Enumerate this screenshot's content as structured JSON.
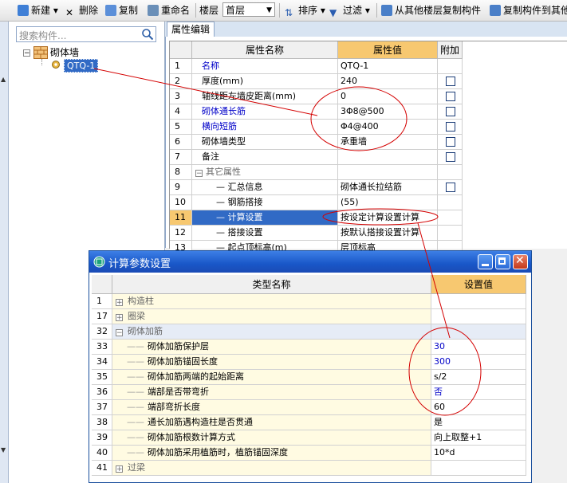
{
  "toolbar": {
    "new_label": "新建",
    "delete_label": "删除",
    "copy_label": "复制",
    "rename_label": "重命名",
    "floor_label": "楼层",
    "floor_value": "首层",
    "sort_label": "排序",
    "filter_label": "过滤",
    "copy_from_floor_label": "从其他楼层复制构件",
    "copy_to_floor_label": "复制构件到其他"
  },
  "left": {
    "search_placeholder": "搜索构件...",
    "tree_root": "砌体墙",
    "tree_child": "QTQ-1"
  },
  "props": {
    "tab": "属性编辑",
    "header_name": "属性名称",
    "header_value": "属性值",
    "header_extra": "附加",
    "rows": [
      {
        "n": "1",
        "name": "名称",
        "value": "QTQ-1",
        "blue": true,
        "check": false
      },
      {
        "n": "2",
        "name": "厚度(mm)",
        "value": "240",
        "blue": false,
        "check": true
      },
      {
        "n": "3",
        "name": "轴线距左墙皮距离(mm)",
        "value": "0",
        "blue": false,
        "check": true
      },
      {
        "n": "4",
        "name": "砌体通长筋",
        "value": "3Φ8@500",
        "blue": true,
        "check": true
      },
      {
        "n": "5",
        "name": "横向短筋",
        "value": "Φ4@400",
        "blue": true,
        "check": true
      },
      {
        "n": "6",
        "name": "砌体墙类型",
        "value": "承重墙",
        "blue": false,
        "check": true
      },
      {
        "n": "7",
        "name": "备注",
        "value": "",
        "blue": false,
        "check": true
      },
      {
        "n": "8",
        "name": "其它属性",
        "value": "",
        "blue": false,
        "check": false
      },
      {
        "n": "9",
        "name": "汇总信息",
        "value": "砌体通长拉结筋",
        "blue": false,
        "check": true
      },
      {
        "n": "10",
        "name": "钢筋搭接",
        "value": "(55)",
        "blue": false,
        "check": false
      },
      {
        "n": "11",
        "name": "计算设置",
        "value": "按设定计算设置计算",
        "blue": false,
        "check": false
      },
      {
        "n": "12",
        "name": "搭接设置",
        "value": "按默认搭接设置计算",
        "blue": false,
        "check": false
      },
      {
        "n": "13",
        "name": "起点顶标高(m)",
        "value": "层顶标高",
        "blue": false,
        "check": false
      }
    ]
  },
  "dialog": {
    "title": "计算参数设置",
    "header_name": "类型名称",
    "header_value": "设置值",
    "rows": [
      {
        "n": "1",
        "name": "构造柱",
        "value": "",
        "group": true,
        "expander": "+"
      },
      {
        "n": "17",
        "name": "圈梁",
        "value": "",
        "group": true,
        "expander": "+"
      },
      {
        "n": "32",
        "name": "砌体加筋",
        "value": "",
        "group": true,
        "expander": "−"
      },
      {
        "n": "33",
        "name": "砌体加筋保护层",
        "value": "30",
        "group": false,
        "blue": true
      },
      {
        "n": "34",
        "name": "砌体加筋锚固长度",
        "value": "300",
        "group": false,
        "blue": true
      },
      {
        "n": "35",
        "name": "砌体加筋两端的起始距离",
        "value": "s/2",
        "group": false,
        "blue": false
      },
      {
        "n": "36",
        "name": "端部是否带弯折",
        "value": "否",
        "group": false,
        "blue": true
      },
      {
        "n": "37",
        "name": "端部弯折长度",
        "value": "60",
        "group": false,
        "blue": false
      },
      {
        "n": "38",
        "name": "通长加筋遇构造柱是否贯通",
        "value": "是",
        "group": false,
        "blue": false
      },
      {
        "n": "39",
        "name": "砌体加筋根数计算方式",
        "value": "向上取整+1",
        "group": false,
        "blue": false
      },
      {
        "n": "40",
        "name": "砌体加筋采用植筋时，植筋锚固深度",
        "value": "10*d",
        "group": false,
        "blue": false
      },
      {
        "n": "41",
        "name": "过梁",
        "value": "",
        "group": true,
        "expander": "+"
      }
    ]
  },
  "colors": {
    "header_bg": "#f7c870",
    "selected_row": "#316ac5",
    "annotation": "#d40000",
    "blue_text": "#0000c8"
  }
}
